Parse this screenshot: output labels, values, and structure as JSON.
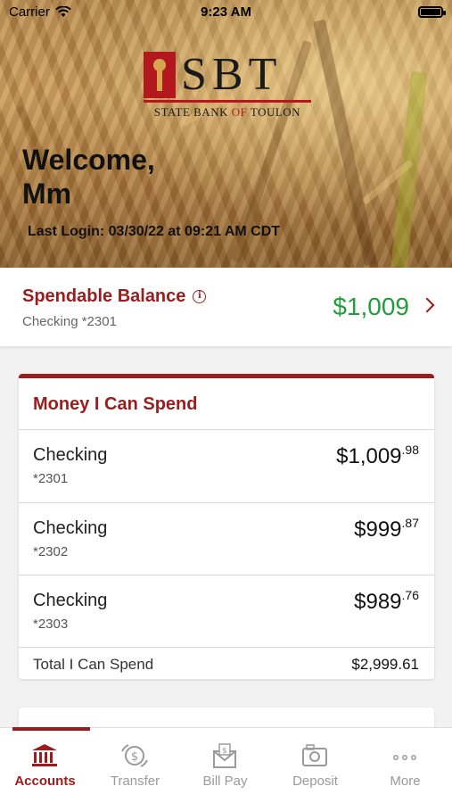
{
  "status_bar": {
    "carrier": "Carrier",
    "time": "9:23 AM"
  },
  "brand": {
    "logo_letters": "SBT",
    "name_part1": "STATE BANK ",
    "name_of": "OF",
    "name_part2": " TOULON",
    "accent_color": "#9b1c1c"
  },
  "header": {
    "welcome_line1": "Welcome,",
    "welcome_line2": "Mm",
    "last_login": "Last Login: 03/30/22 at 09:21 AM CDT"
  },
  "spendable": {
    "title": "Spendable Balance",
    "account": "Checking *2301",
    "amount": "$1,009",
    "amount_color": "#1f9e3b"
  },
  "money_card": {
    "title": "Money I Can Spend",
    "accounts": [
      {
        "name": "Checking",
        "number": "*2301",
        "dollars": "$1,009",
        "cents": ".98"
      },
      {
        "name": "Checking",
        "number": "*2302",
        "dollars": "$999",
        "cents": ".87"
      },
      {
        "name": "Checking",
        "number": "*2303",
        "dollars": "$989",
        "cents": ".76"
      }
    ],
    "total_label": "Total I Can Spend",
    "total_value": "$2,999.61"
  },
  "tabs": [
    {
      "label": "Accounts",
      "icon": "bank-icon",
      "active": true
    },
    {
      "label": "Transfer",
      "icon": "transfer-icon",
      "active": false
    },
    {
      "label": "Bill Pay",
      "icon": "bill-pay-icon",
      "active": false
    },
    {
      "label": "Deposit",
      "icon": "camera-icon",
      "active": false
    },
    {
      "label": "More",
      "icon": "more-icon",
      "active": false
    }
  ]
}
